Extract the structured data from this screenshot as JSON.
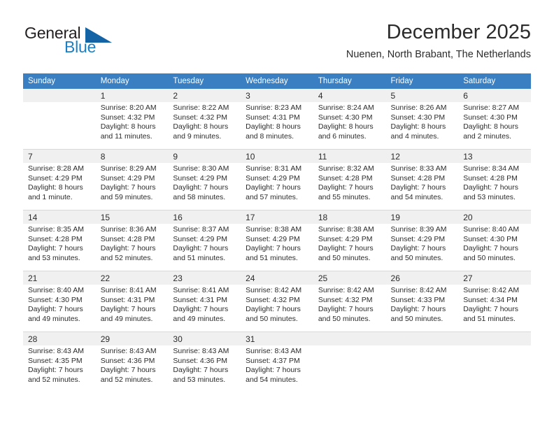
{
  "brand": {
    "word_one": "General",
    "word_two": "Blue",
    "triangle_color": "#1464a5",
    "blue_color": "#1c7fc4"
  },
  "header": {
    "title": "December 2025",
    "subtitle": "Nuenen, North Brabant, The Netherlands"
  },
  "colors": {
    "header_row_bg": "#3a7fc1",
    "header_row_text": "#ffffff",
    "shaded_band": "#f0f0f0",
    "grid_line": "#d9d9d9",
    "text": "#2b2b2b"
  },
  "weekdays": [
    "Sunday",
    "Monday",
    "Tuesday",
    "Wednesday",
    "Thursday",
    "Friday",
    "Saturday"
  ],
  "weeks": [
    [
      {
        "day": ""
      },
      {
        "day": "1",
        "sunrise": "Sunrise: 8:20 AM",
        "sunset": "Sunset: 4:32 PM",
        "daylight1": "Daylight: 8 hours",
        "daylight2": "and 11 minutes."
      },
      {
        "day": "2",
        "sunrise": "Sunrise: 8:22 AM",
        "sunset": "Sunset: 4:32 PM",
        "daylight1": "Daylight: 8 hours",
        "daylight2": "and 9 minutes."
      },
      {
        "day": "3",
        "sunrise": "Sunrise: 8:23 AM",
        "sunset": "Sunset: 4:31 PM",
        "daylight1": "Daylight: 8 hours",
        "daylight2": "and 8 minutes."
      },
      {
        "day": "4",
        "sunrise": "Sunrise: 8:24 AM",
        "sunset": "Sunset: 4:30 PM",
        "daylight1": "Daylight: 8 hours",
        "daylight2": "and 6 minutes."
      },
      {
        "day": "5",
        "sunrise": "Sunrise: 8:26 AM",
        "sunset": "Sunset: 4:30 PM",
        "daylight1": "Daylight: 8 hours",
        "daylight2": "and 4 minutes."
      },
      {
        "day": "6",
        "sunrise": "Sunrise: 8:27 AM",
        "sunset": "Sunset: 4:30 PM",
        "daylight1": "Daylight: 8 hours",
        "daylight2": "and 2 minutes."
      }
    ],
    [
      {
        "day": "7",
        "sunrise": "Sunrise: 8:28 AM",
        "sunset": "Sunset: 4:29 PM",
        "daylight1": "Daylight: 8 hours",
        "daylight2": "and 1 minute."
      },
      {
        "day": "8",
        "sunrise": "Sunrise: 8:29 AM",
        "sunset": "Sunset: 4:29 PM",
        "daylight1": "Daylight: 7 hours",
        "daylight2": "and 59 minutes."
      },
      {
        "day": "9",
        "sunrise": "Sunrise: 8:30 AM",
        "sunset": "Sunset: 4:29 PM",
        "daylight1": "Daylight: 7 hours",
        "daylight2": "and 58 minutes."
      },
      {
        "day": "10",
        "sunrise": "Sunrise: 8:31 AM",
        "sunset": "Sunset: 4:29 PM",
        "daylight1": "Daylight: 7 hours",
        "daylight2": "and 57 minutes."
      },
      {
        "day": "11",
        "sunrise": "Sunrise: 8:32 AM",
        "sunset": "Sunset: 4:28 PM",
        "daylight1": "Daylight: 7 hours",
        "daylight2": "and 55 minutes."
      },
      {
        "day": "12",
        "sunrise": "Sunrise: 8:33 AM",
        "sunset": "Sunset: 4:28 PM",
        "daylight1": "Daylight: 7 hours",
        "daylight2": "and 54 minutes."
      },
      {
        "day": "13",
        "sunrise": "Sunrise: 8:34 AM",
        "sunset": "Sunset: 4:28 PM",
        "daylight1": "Daylight: 7 hours",
        "daylight2": "and 53 minutes."
      }
    ],
    [
      {
        "day": "14",
        "sunrise": "Sunrise: 8:35 AM",
        "sunset": "Sunset: 4:28 PM",
        "daylight1": "Daylight: 7 hours",
        "daylight2": "and 53 minutes."
      },
      {
        "day": "15",
        "sunrise": "Sunrise: 8:36 AM",
        "sunset": "Sunset: 4:28 PM",
        "daylight1": "Daylight: 7 hours",
        "daylight2": "and 52 minutes."
      },
      {
        "day": "16",
        "sunrise": "Sunrise: 8:37 AM",
        "sunset": "Sunset: 4:29 PM",
        "daylight1": "Daylight: 7 hours",
        "daylight2": "and 51 minutes."
      },
      {
        "day": "17",
        "sunrise": "Sunrise: 8:38 AM",
        "sunset": "Sunset: 4:29 PM",
        "daylight1": "Daylight: 7 hours",
        "daylight2": "and 51 minutes."
      },
      {
        "day": "18",
        "sunrise": "Sunrise: 8:38 AM",
        "sunset": "Sunset: 4:29 PM",
        "daylight1": "Daylight: 7 hours",
        "daylight2": "and 50 minutes."
      },
      {
        "day": "19",
        "sunrise": "Sunrise: 8:39 AM",
        "sunset": "Sunset: 4:29 PM",
        "daylight1": "Daylight: 7 hours",
        "daylight2": "and 50 minutes."
      },
      {
        "day": "20",
        "sunrise": "Sunrise: 8:40 AM",
        "sunset": "Sunset: 4:30 PM",
        "daylight1": "Daylight: 7 hours",
        "daylight2": "and 50 minutes."
      }
    ],
    [
      {
        "day": "21",
        "sunrise": "Sunrise: 8:40 AM",
        "sunset": "Sunset: 4:30 PM",
        "daylight1": "Daylight: 7 hours",
        "daylight2": "and 49 minutes."
      },
      {
        "day": "22",
        "sunrise": "Sunrise: 8:41 AM",
        "sunset": "Sunset: 4:31 PM",
        "daylight1": "Daylight: 7 hours",
        "daylight2": "and 49 minutes."
      },
      {
        "day": "23",
        "sunrise": "Sunrise: 8:41 AM",
        "sunset": "Sunset: 4:31 PM",
        "daylight1": "Daylight: 7 hours",
        "daylight2": "and 49 minutes."
      },
      {
        "day": "24",
        "sunrise": "Sunrise: 8:42 AM",
        "sunset": "Sunset: 4:32 PM",
        "daylight1": "Daylight: 7 hours",
        "daylight2": "and 50 minutes."
      },
      {
        "day": "25",
        "sunrise": "Sunrise: 8:42 AM",
        "sunset": "Sunset: 4:32 PM",
        "daylight1": "Daylight: 7 hours",
        "daylight2": "and 50 minutes."
      },
      {
        "day": "26",
        "sunrise": "Sunrise: 8:42 AM",
        "sunset": "Sunset: 4:33 PM",
        "daylight1": "Daylight: 7 hours",
        "daylight2": "and 50 minutes."
      },
      {
        "day": "27",
        "sunrise": "Sunrise: 8:42 AM",
        "sunset": "Sunset: 4:34 PM",
        "daylight1": "Daylight: 7 hours",
        "daylight2": "and 51 minutes."
      }
    ],
    [
      {
        "day": "28",
        "sunrise": "Sunrise: 8:43 AM",
        "sunset": "Sunset: 4:35 PM",
        "daylight1": "Daylight: 7 hours",
        "daylight2": "and 52 minutes."
      },
      {
        "day": "29",
        "sunrise": "Sunrise: 8:43 AM",
        "sunset": "Sunset: 4:36 PM",
        "daylight1": "Daylight: 7 hours",
        "daylight2": "and 52 minutes."
      },
      {
        "day": "30",
        "sunrise": "Sunrise: 8:43 AM",
        "sunset": "Sunset: 4:36 PM",
        "daylight1": "Daylight: 7 hours",
        "daylight2": "and 53 minutes."
      },
      {
        "day": "31",
        "sunrise": "Sunrise: 8:43 AM",
        "sunset": "Sunset: 4:37 PM",
        "daylight1": "Daylight: 7 hours",
        "daylight2": "and 54 minutes."
      },
      {
        "day": ""
      },
      {
        "day": ""
      },
      {
        "day": ""
      }
    ]
  ]
}
